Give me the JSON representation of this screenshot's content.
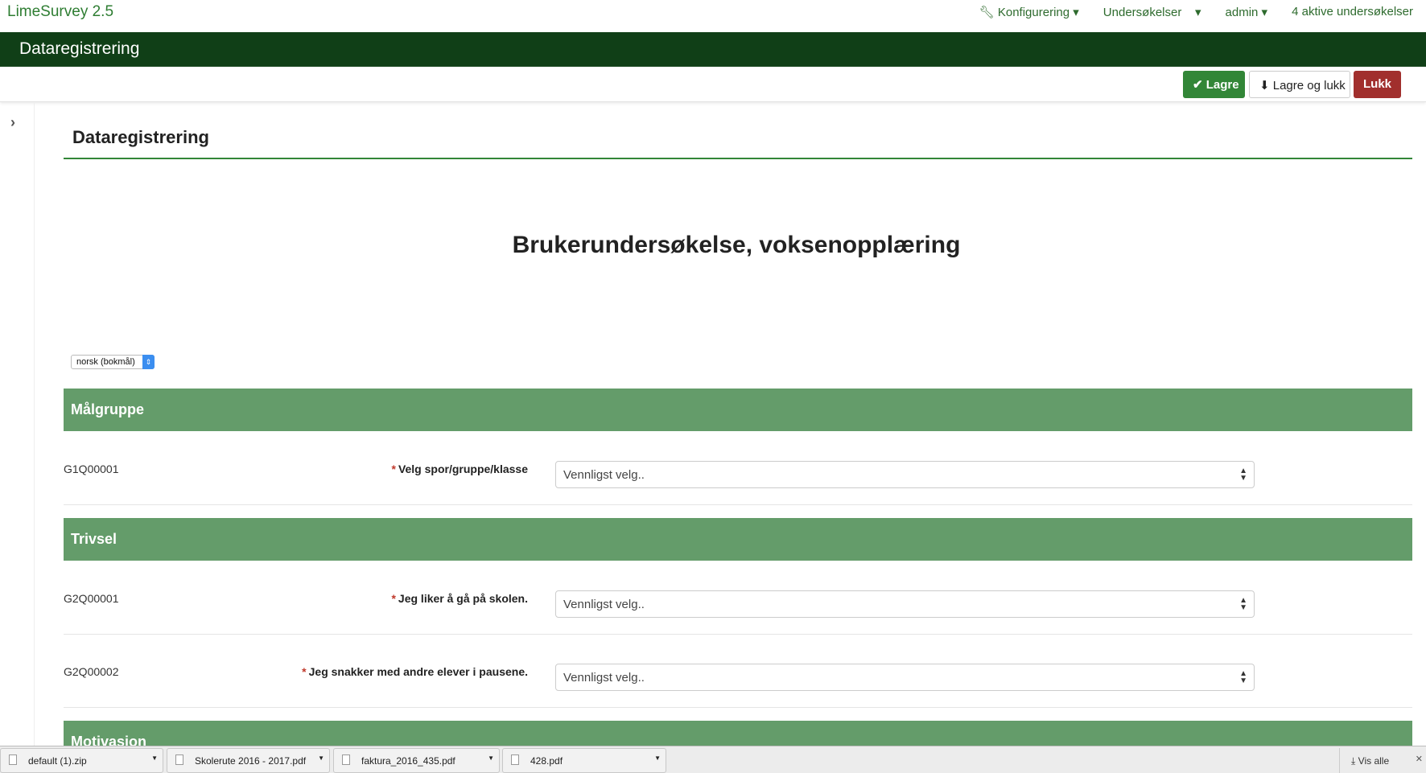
{
  "app": {
    "brand": "LimeSurvey 2.5"
  },
  "nav": {
    "config": "Konfigurering",
    "surveys": "Undersøkelser",
    "user": "admin",
    "active": "4 aktive undersøkelser"
  },
  "header": {
    "title": "Dataregistrering"
  },
  "toolbar": {
    "save": "Lagre",
    "save_close": "Lagre og lukk",
    "close": "Lukk"
  },
  "page": {
    "title": "Dataregistrering",
    "survey_title": "Brukerundersøkelse, voksenopplæring",
    "language": "norsk (bokmål)"
  },
  "groups": [
    {
      "title": "Målgruppe",
      "questions": [
        {
          "code": "G1Q00001",
          "text": "Velg spor/gruppe/klasse",
          "value": "Vennligst velg.."
        }
      ]
    },
    {
      "title": "Trivsel",
      "questions": [
        {
          "code": "G2Q00001",
          "text": "Jeg liker å gå på skolen.",
          "value": "Vennligst velg.."
        },
        {
          "code": "G2Q00002",
          "text": "Jeg snakker med andre elever i pausene.",
          "value": "Vennligst velg.."
        }
      ]
    },
    {
      "title": "Motivasjon"
    }
  ],
  "required_mark": "*",
  "downloads": {
    "items": [
      "default (1).zip",
      "Skolerute 2016 - 2017.pdf",
      "faktura_2016_435.pdf",
      "428.pdf"
    ],
    "show_all": "Vis alle"
  }
}
